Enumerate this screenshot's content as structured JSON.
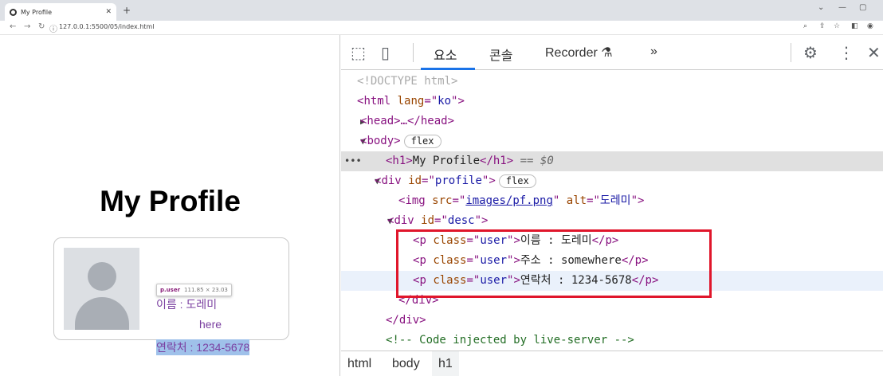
{
  "browser": {
    "tab_title": "My Profile",
    "tab_close": "✕",
    "new_tab": "+",
    "url": "127.0.0.1:5500/05/index.html",
    "win_controls": [
      "⌄",
      "—",
      "▢"
    ],
    "nav": [
      "←",
      "→",
      "↻",
      "ⓘ"
    ]
  },
  "page": {
    "title": "My Profile",
    "desc": [
      "이름 : 도레미",
      "주소 : somewhere",
      "연락처 : 1234-5678"
    ],
    "hover_tip": {
      "selector": "p.user",
      "size": "111.85 × 23.03"
    },
    "line2_visible_tail": "here"
  },
  "devtools": {
    "tabs": [
      "요소",
      "콘솔",
      "Recorder",
      "»"
    ],
    "tab_recorder_icon": "flask-icon",
    "code": {
      "doctype": "<!DOCTYPE html>",
      "html_open_tag": "html",
      "lang_attr": "lang",
      "lang_val": "ko",
      "head_collapsed": "<head>…</head>",
      "body_tag": "body",
      "flex_badge": "flex",
      "h1_text": "My Profile",
      "selected_marker": "== $0",
      "div_tag": "div",
      "id_attr": "id",
      "profile_id": "profile",
      "img_tag": "img",
      "src_attr": "src",
      "img_src": "images/pf.png",
      "alt_attr": "alt",
      "alt_val": "도레미",
      "desc_id": "desc",
      "p_tag": "p",
      "class_attr": "class",
      "class_val": "user",
      "p_texts": [
        "이름 : 도레미",
        "주소 : somewhere",
        "연락처 : 1234-5678"
      ],
      "close_div": "</div>",
      "comment": "<!-- Code injected by live-server -->"
    },
    "breadcrumbs": [
      "html",
      "body",
      "h1"
    ],
    "colors": {
      "accent": "#1a73e8",
      "highlight_box": "#e0162b",
      "tag": "#881280",
      "attr_name": "#994500",
      "attr_value": "#1a1aa6"
    }
  }
}
